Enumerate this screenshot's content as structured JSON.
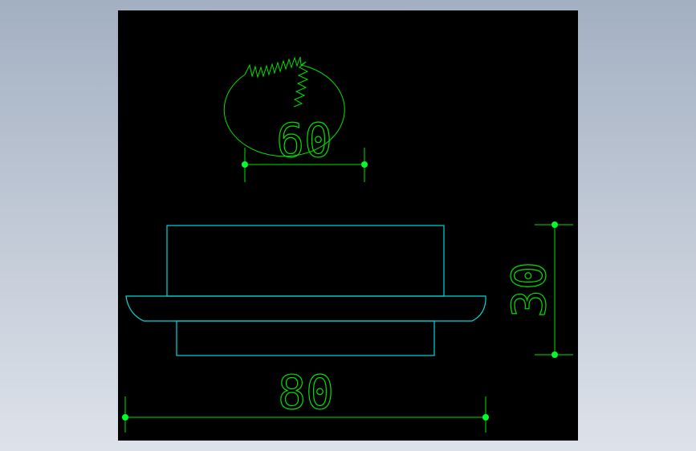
{
  "colors": {
    "background": "#000000",
    "part_outline": "#00d8d8",
    "dimension": "#00e000",
    "dimension_point": "#00ff2a"
  },
  "drawing": {
    "dimensions": {
      "top_width": "60",
      "bottom_width": "80",
      "height": "30"
    }
  }
}
